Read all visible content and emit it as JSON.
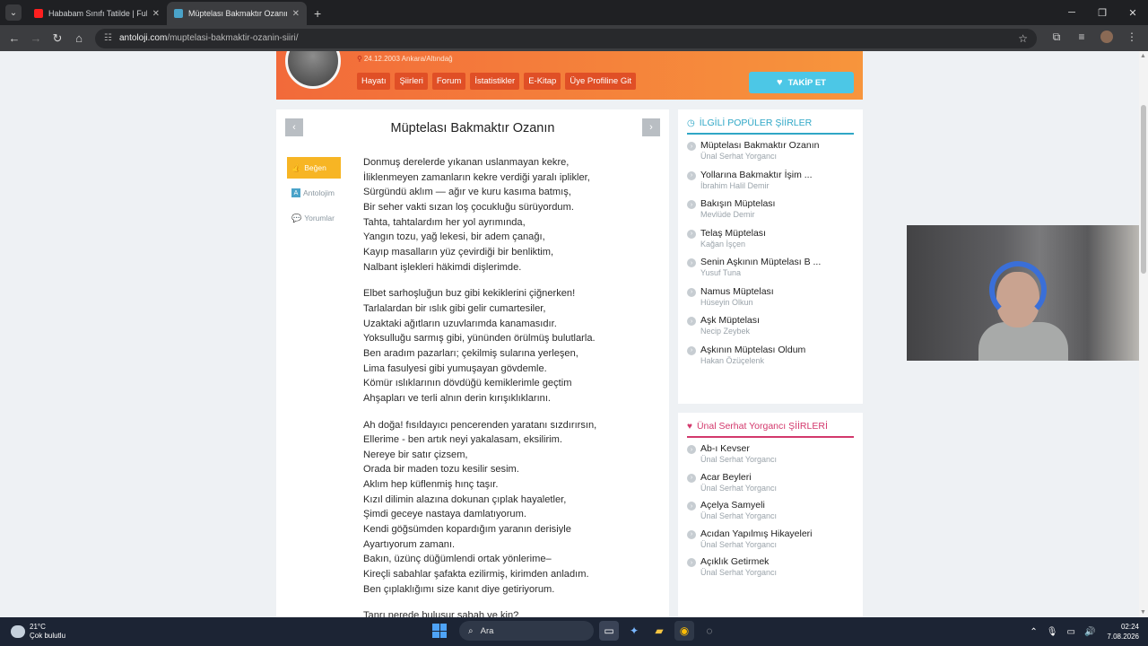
{
  "browser": {
    "tabs": [
      {
        "title": "Hababam Sınıfı Tatilde | Full HD",
        "favicon_color": "#ff1f1f",
        "active": false
      },
      {
        "title": "Müptelası Bakmaktır Ozanın Şiiri",
        "favicon_color": "#4aa3c9",
        "active": true
      }
    ],
    "new_tab": "+",
    "url_host": "antoloji.com",
    "url_path": "/muptelasi-bakmaktir-ozanin-siiri/"
  },
  "profile": {
    "date": "24.12.2003 Ankara/Altındağ",
    "menu": [
      "Hayatı",
      "Şiirleri",
      "Forum",
      "İstatistikler",
      "E-Kitap",
      "Üye Profiline Git"
    ],
    "follow_label": "TAKİP ET"
  },
  "poem": {
    "title": "Müptelası Bakmaktır Ozanın",
    "actions": {
      "like": "Beğen",
      "antolojim": "Antolojim",
      "comments": "Yorumlar"
    },
    "stanzas": [
      [
        "Donmuş derelerde yıkanan uslanmayan kekre,",
        "İliklenmeyen zamanların kekre verdiği yaralı iplikler,",
        "Sürgündü aklım — ağır ve kuru kasıma batmış,",
        "Bir seher vakti sızan loş çocukluğu sürüyordum.",
        "Tahta, tahtalardım her yol ayrımında,",
        "Yangın tozu, yağ lekesi, bir adem çanağı,",
        "Kayıp masalların yüz çevirdiği bir benliktim,",
        "Nalbant işlekleri häkimdi dişlerimde."
      ],
      [
        "Elbet sarhoşluğun buz gibi kekiklerini çiğnerken!",
        "Tarlalardan bir ıslık gibi gelir cumartesiler,",
        "Uzaktaki ağıtların uzuvlarımda kanamasıdır.",
        "Yoksulluğu sarmış gibi, yününden örülmüş bulutlarla.",
        "Ben aradım pazarları; çekilmiş sularına yerleşen,",
        "Lima fasulyesi gibi yumuşayan gövdemle.",
        "Kömür ıslıklarının dövdüğü kemiklerimle geçtim",
        "Ahşapları ve terli alnın derin kırışıklıklarını."
      ],
      [
        "Ah doğa! fısıldayıcı pencerenden yaratanı sızdırırsın,",
        "Ellerime - ben artık neyi yakalasam, eksilirim.",
        "Nereye bir satır çizsem,",
        "Orada bir maden tozu kesilir sesim.",
        "Aklım hep küflenmiş hınç taşır.",
        "Kızıl dilimin alazına dokunan çıplak hayaletler,",
        "Şimdi geceye nastaya damlatıyorum.",
        "Kendi göğsümden kopardığım yaranın derisiyle",
        "Ayartıyorum zamanı.",
        "Bakın, üzünç düğümlendi ortak yönlerime–",
        "Kireçli sabahlar şafakta ezilirmiş, kirimden anladım.",
        "Ben çıplaklığımı size kanıt diye getiriyorum."
      ],
      [
        "Tanrı nerede buluşur sabah ve kin?"
      ]
    ]
  },
  "popular": {
    "heading": "İLGİLİ POPÜLER ŞİİRLER",
    "items": [
      {
        "title": "Müptelası Bakmaktır Ozanın",
        "author": "Ünal Serhat Yorgancı"
      },
      {
        "title": "Yollarına Bakmaktır İşim ...",
        "author": "İbrahim Halil Demir"
      },
      {
        "title": "Bakışın Müptelası",
        "author": "Mevlüde Demir"
      },
      {
        "title": "Telaş Müptelası",
        "author": "Kağan İşçen"
      },
      {
        "title": "Senin Aşkının Müptelası B ...",
        "author": "Yusuf Tuna"
      },
      {
        "title": "Namus Müptelası",
        "author": "Hüseyin Olkun"
      },
      {
        "title": "Aşk Müptelası",
        "author": "Necip Zeybek"
      },
      {
        "title": "Aşkının Müptelası Oldum",
        "author": "Hakan Özüçelenk"
      }
    ]
  },
  "author_poems": {
    "heading": "Ünal Serhat Yorgancı ŞİİRLERİ",
    "items": [
      {
        "title": "Ab-ı Kevser",
        "author": "Ünal Serhat Yorgancı"
      },
      {
        "title": "Acar Beyleri",
        "author": "Ünal Serhat Yorgancı"
      },
      {
        "title": "Açelya Samyeli",
        "author": "Ünal Serhat Yorgancı"
      },
      {
        "title": "Acıdan Yapılmış Hikayeleri",
        "author": "Ünal Serhat Yorgancı"
      },
      {
        "title": "Açıklık Getirmek",
        "author": "Ünal Serhat Yorgancı"
      }
    ]
  },
  "taskbar": {
    "temp": "21°C",
    "weather": "Çok bulutlu",
    "search_placeholder": "Ara",
    "time": "02:24",
    "date": "7.08.2026"
  },
  "colors": {
    "profile_orange": "#f26a3a",
    "follow_cyan": "#4cc7e6",
    "like_yellow": "#f7b524",
    "popular_accent": "#2fa7c6",
    "author_accent": "#d3386c"
  }
}
